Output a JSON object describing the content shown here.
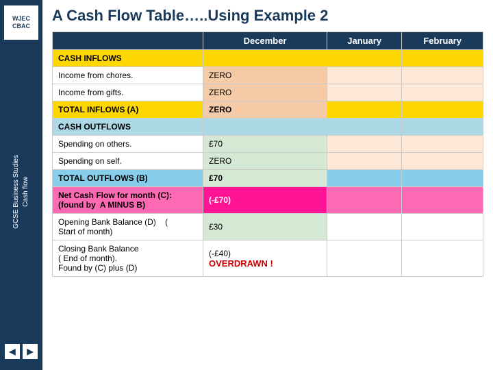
{
  "sidebar": {
    "logo_line1": "WJEC",
    "logo_line2": "CBAC",
    "text_line1": "GCSE Business Studies",
    "text_line2": "Cash flow",
    "nav": {
      "prev_label": "◀",
      "next_label": "▶"
    }
  },
  "page": {
    "title": "A Cash Flow Table…..Using Example 2"
  },
  "table": {
    "headers": {
      "col0": "",
      "col1": "December",
      "col2": "January",
      "col3": "February"
    },
    "sections": {
      "cash_inflows": "CASH INFLOWS",
      "cash_outflows": "CASH OUTFLOWS"
    },
    "rows": [
      {
        "label": "Income from chores.",
        "dec": "ZERO",
        "jan": "",
        "feb": ""
      },
      {
        "label": "Income from gifts.",
        "dec": "ZERO",
        "jan": "",
        "feb": ""
      },
      {
        "label": "TOTAL INFLOWS (A)",
        "dec": "ZERO",
        "jan": "",
        "feb": ""
      },
      {
        "label": "Spending on others.",
        "dec": "£70",
        "jan": "",
        "feb": ""
      },
      {
        "label": "Spending on self.",
        "dec": "ZERO",
        "jan": "",
        "feb": ""
      },
      {
        "label": "TOTAL OUTFLOWS (B)",
        "dec": "£70",
        "jan": "",
        "feb": ""
      },
      {
        "label": "Net Cash Flow for month (C):\n(found by  A MINUS B)",
        "dec": "(-£70)",
        "jan": "",
        "feb": ""
      },
      {
        "label": "Opening Bank Balance (D)    (\nStart of month)",
        "dec": "£30",
        "jan": "",
        "feb": ""
      },
      {
        "label": "Closing Bank Balance\n( End of month).\nFound by (C) plus (D)",
        "dec_line1": "(-£40)",
        "dec_line2": "OVERDRAWN !",
        "jan": "",
        "feb": ""
      }
    ]
  }
}
